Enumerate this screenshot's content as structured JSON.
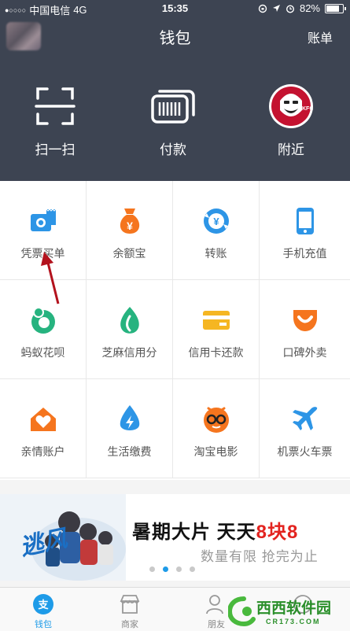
{
  "status_bar": {
    "carrier": "中国电信",
    "network": "4G",
    "time": "15:35",
    "battery": "82%",
    "battery_level": 0.82
  },
  "header": {
    "title": "钱包",
    "bill_label": "账单"
  },
  "big_actions": [
    {
      "label": "扫一扫",
      "icon": "scan-icon"
    },
    {
      "label": "付款",
      "icon": "barcode-icon"
    },
    {
      "label": "附近",
      "icon": "kfc-logo"
    }
  ],
  "services": [
    {
      "label": "凭票买单",
      "icon": "receipt-camera-icon"
    },
    {
      "label": "余额宝",
      "icon": "money-bag-icon"
    },
    {
      "label": "转账",
      "icon": "transfer-icon"
    },
    {
      "label": "手机充值",
      "icon": "phone-icon"
    },
    {
      "label": "蚂蚁花呗",
      "icon": "huabei-icon"
    },
    {
      "label": "芝麻信用分",
      "icon": "sesame-icon"
    },
    {
      "label": "信用卡还款",
      "icon": "credit-card-icon"
    },
    {
      "label": "口碑外卖",
      "icon": "koubei-icon"
    },
    {
      "label": "亲情账户",
      "icon": "family-heart-icon"
    },
    {
      "label": "生活缴费",
      "icon": "utility-drop-icon"
    },
    {
      "label": "淘宝电影",
      "icon": "taobao-movie-icon"
    },
    {
      "label": "机票火车票",
      "icon": "airplane-icon"
    }
  ],
  "banner": {
    "headline_prefix": "暑期大片 天天",
    "headline_highlight": "8块8",
    "subline": "数量有限  抢完为止",
    "art_text": "逃风",
    "page_count": 4,
    "active_page": 2
  },
  "tabbar": [
    {
      "label": "钱包",
      "icon": "alipay-wallet-icon",
      "active": true
    },
    {
      "label": "商家",
      "icon": "shop-icon",
      "active": false
    },
    {
      "label": "朋友",
      "icon": "friends-icon",
      "active": false
    },
    {
      "label": "",
      "icon": "more-icon",
      "active": false
    }
  ],
  "watermark": {
    "text": "西西软件园",
    "url_text": "CR173.COM"
  },
  "colors": {
    "header_bg": "#3d4452",
    "accent_blue": "#1e9be8",
    "orange": "#f5751e",
    "green": "#26b37f",
    "red": "#e3231f",
    "yellow": "#f5b622"
  }
}
